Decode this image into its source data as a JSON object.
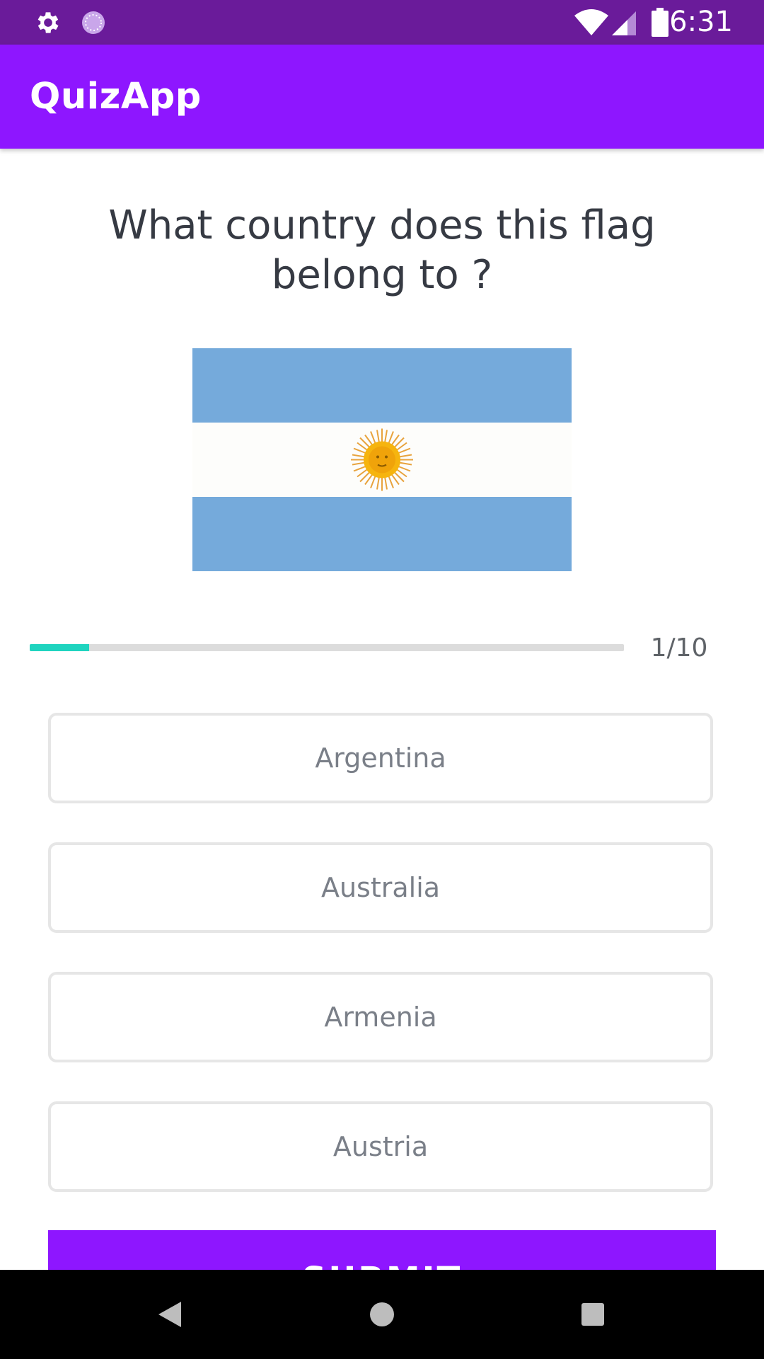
{
  "status_bar": {
    "time": "6:31",
    "left_icons": [
      "gear-icon",
      "sync-icon"
    ],
    "right_icons": [
      "wifi-icon",
      "signal-icon",
      "battery-icon"
    ]
  },
  "app_bar": {
    "title": "QuizApp"
  },
  "question": {
    "text": "What country does this flag belong to ?",
    "flag_icon": "argentina-flag"
  },
  "progress": {
    "current": 1,
    "total": 10,
    "label": "1/10",
    "fraction": 0.1
  },
  "options": [
    {
      "label": "Argentina"
    },
    {
      "label": "Australia"
    },
    {
      "label": "Armenia"
    },
    {
      "label": "Austria"
    }
  ],
  "submit": {
    "label": "SUBMIT"
  },
  "nav_bar": {
    "icons": [
      "back-icon",
      "home-icon",
      "recents-icon"
    ]
  },
  "colors": {
    "status_bar": "#6a1b9a",
    "primary": "#8e16ff",
    "progress_fill": "#1fd4bf",
    "flag_blue": "#75aadb",
    "flag_sun": "#f6b40e"
  }
}
